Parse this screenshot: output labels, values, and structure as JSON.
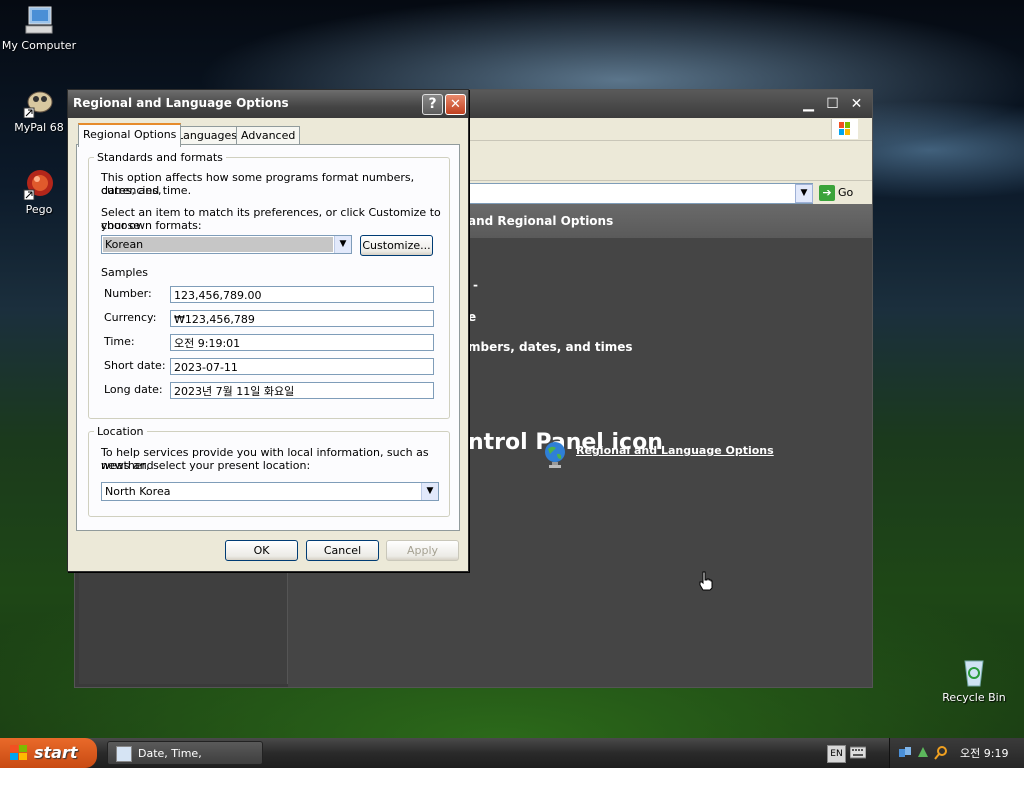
{
  "desktop": {
    "icons": [
      {
        "label": "My Computer"
      },
      {
        "label": "MyPal 68"
      },
      {
        "label": "Pego"
      },
      {
        "label": "Recycle Bin"
      }
    ]
  },
  "control_panel": {
    "address": {
      "go_label": "Go"
    },
    "header_text": "and Regional Options",
    "task_lines": [
      "-",
      "e",
      "mbers, dates, and times"
    ],
    "pick_heading": "ntrol Panel icon",
    "link_label": "Regional and Language Options"
  },
  "dialog": {
    "title": "Regional and Language Options",
    "tabs": [
      {
        "label": "Regional Options",
        "active": true
      },
      {
        "label": "Languages",
        "active": false
      },
      {
        "label": "Advanced",
        "active": false
      }
    ],
    "standards": {
      "group_label": "Standards and formats",
      "desc_line1": "This option affects how some programs format numbers, currencies,",
      "desc_line2": "dates, and time.",
      "select_line1": "Select an item to match its preferences, or click Customize to choose",
      "select_line2": "your own formats:",
      "selected_format": "Korean",
      "customize_label": "Customize...",
      "samples_label": "Samples",
      "samples": [
        {
          "label": "Number:",
          "value": "123,456,789.00"
        },
        {
          "label": "Currency:",
          "value": "₩123,456,789"
        },
        {
          "label": "Time:",
          "value": "오전 9:19:01"
        },
        {
          "label": "Short date:",
          "value": "2023-07-11"
        },
        {
          "label": "Long date:",
          "value": "2023년 7월 11일 화요일"
        }
      ]
    },
    "location": {
      "group_label": "Location",
      "desc_line1": "To help services provide you with local information, such as news and",
      "desc_line2": "weather, select your present location:",
      "selected_location": "North Korea"
    },
    "buttons": {
      "ok": "OK",
      "cancel": "Cancel",
      "apply": "Apply"
    }
  },
  "taskbar": {
    "start_label": "start",
    "task_item_label": "Date, Time, Languag...",
    "language_indicator": "EN",
    "clock": "오전 9:19"
  },
  "colors": {
    "start_button": "#d9581c",
    "tab_highlight": "#e68b2c",
    "close_button": "#c0401f"
  }
}
